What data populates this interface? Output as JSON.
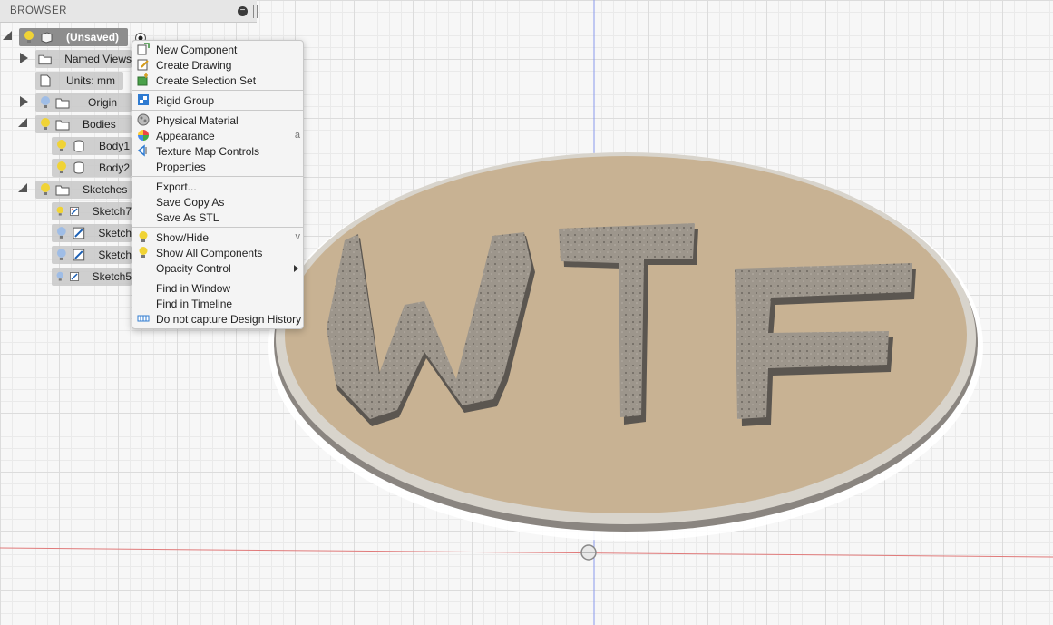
{
  "browser": {
    "title": "BROWSER",
    "collapse_symbol": "−",
    "root": {
      "label": "(Unsaved)"
    },
    "named_views": "Named Views",
    "units": "Units: mm",
    "origin": "Origin",
    "bodies": {
      "label": "Bodies",
      "items": [
        "Body1",
        "Body2"
      ]
    },
    "sketches": {
      "label": "Sketches",
      "items": [
        "Sketch7",
        "Sketch",
        "Sketch",
        "Sketch5"
      ]
    }
  },
  "context_menu": {
    "items": [
      {
        "label": "New Component",
        "icon": "new-component-icon"
      },
      {
        "label": "Create Drawing",
        "icon": "create-drawing-icon"
      },
      {
        "label": "Create Selection Set",
        "icon": "selection-set-icon"
      },
      {
        "label": "Rigid Group",
        "icon": "rigid-group-icon"
      },
      {
        "label": "Physical Material",
        "icon": "physical-material-icon"
      },
      {
        "label": "Appearance",
        "icon": "appearance-icon",
        "shortcut": "a"
      },
      {
        "label": "Texture Map Controls",
        "icon": "texture-map-icon"
      },
      {
        "label": "Properties",
        "icon": ""
      },
      {
        "label": "Export...",
        "icon": ""
      },
      {
        "label": "Save Copy As",
        "icon": ""
      },
      {
        "label": "Save As STL",
        "icon": ""
      },
      {
        "label": "Show/Hide",
        "icon": "lightbulb-icon",
        "shortcut": "v"
      },
      {
        "label": "Show All Components",
        "icon": "lightbulb-icon"
      },
      {
        "label": "Opacity Control",
        "icon": "",
        "submenu": true
      },
      {
        "label": "Find in Window",
        "icon": ""
      },
      {
        "label": "Find in Timeline",
        "icon": ""
      },
      {
        "label": "Do not capture Design History",
        "icon": "design-history-icon"
      }
    ]
  },
  "model": {
    "text": "WTF",
    "plate_color": "#c8b293",
    "rim_color": "#8a8580"
  },
  "colors": {
    "bulb_on": "#f0d335",
    "bulb_off": "#9fbde6",
    "x_axis": "#e07a7a",
    "y_axis": "#8899ee"
  }
}
